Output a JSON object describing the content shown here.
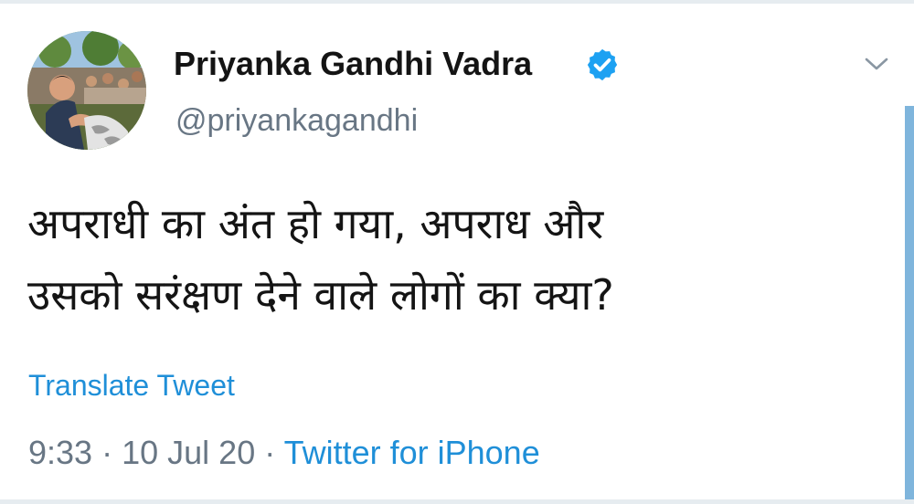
{
  "tweet": {
    "author": {
      "display_name": "Priyanka Gandhi Vadra",
      "handle": "@priyankagandhi",
      "verified": true,
      "avatar_icon": "profile-photo"
    },
    "text_lines": [
      "अपराधी का अंत हो गया, अपराध और",
      "उसको सरंक्षण देने वाले लोगों का क्या?"
    ],
    "translate_label": "Translate Tweet",
    "time": "9:33",
    "date": "10 Jul 20",
    "separator": "·",
    "source": "Twitter for iPhone",
    "menu_icon": "chevron-down-icon"
  },
  "colors": {
    "link": "#1f8fd8",
    "secondary_text": "#687684",
    "primary_text": "#141414",
    "verified_badge": "#1da1f2"
  }
}
